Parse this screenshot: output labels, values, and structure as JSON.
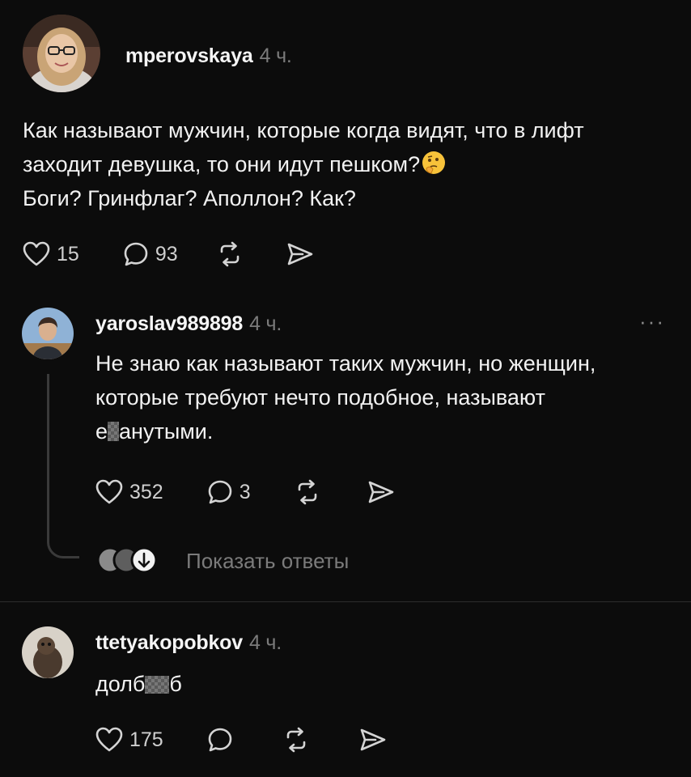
{
  "post": {
    "username": "mperovskaya",
    "time": "4 ч.",
    "lines": [
      "Как называют мужчин, которые когда видят, что в лифт",
      "заходит девушка, то они идут пешком?",
      "Боги? Гринфлаг? Аполлон? Как?"
    ],
    "emoji": "thinking-face",
    "likes": "15",
    "replies": "93"
  },
  "reply1": {
    "username": "yaroslav989898",
    "time": "4 ч.",
    "more": "···",
    "lines": [
      "Не знаю как называют таких мужчин, но женщин,",
      "которые требуют нечто подобное, называют"
    ],
    "line3_start": "е",
    "line3_end": "анутыми.",
    "likes": "352",
    "replies": "3",
    "show_replies": "Показать ответы"
  },
  "reply2": {
    "username": "ttetyakopobkov",
    "time": "4 ч.",
    "text_start": "долб",
    "text_end": "б",
    "likes": "175"
  },
  "colors": {
    "background": "#0c0c0c",
    "muted": "#7b7b7b",
    "divider": "#2d2d2d"
  }
}
